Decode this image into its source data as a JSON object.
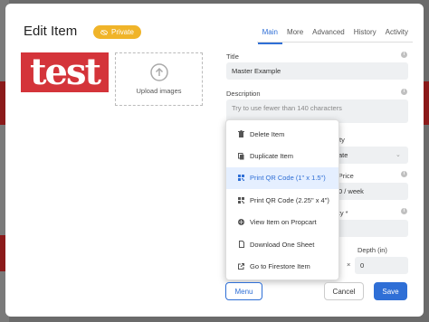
{
  "header": {
    "title": "Edit Item",
    "privacy_badge": "Private"
  },
  "tabs": [
    {
      "label": "Main",
      "active": true
    },
    {
      "label": "More",
      "active": false
    },
    {
      "label": "Advanced",
      "active": false
    },
    {
      "label": "History",
      "active": false
    },
    {
      "label": "Activity",
      "active": false
    }
  ],
  "media": {
    "logo_text": "test",
    "upload_label": "Upload images"
  },
  "form": {
    "title_label": "Title",
    "title_value": "Master Example",
    "description_label": "Description",
    "description_placeholder": "Try to use fewer than 140 characters",
    "visibility_label_partial": "ility",
    "visibility_value_partial": "ate",
    "price_label_partial": "l Price",
    "price_value_partial": "0 / week",
    "quantity_label_partial": "tity *",
    "depth_label": "Depth (in)",
    "depth_value": "0",
    "dimension_separator": "×"
  },
  "menu": {
    "items": [
      {
        "label": "Delete Item",
        "icon": "trash-icon",
        "highlighted": false
      },
      {
        "label": "Duplicate Item",
        "icon": "copy-icon",
        "highlighted": false
      },
      {
        "label": "Print QR Code (1\" x 1.5\")",
        "icon": "qr-code-icon",
        "highlighted": true
      },
      {
        "label": "Print QR Code (2.25\" x 4\")",
        "icon": "qr-code-icon",
        "highlighted": false
      },
      {
        "label": "View Item on Propcart",
        "icon": "globe-icon",
        "highlighted": false
      },
      {
        "label": "Download One Sheet",
        "icon": "document-icon",
        "highlighted": false
      },
      {
        "label": "Go to Firestore Item",
        "icon": "external-link-icon",
        "highlighted": false
      }
    ]
  },
  "footer": {
    "menu_label": "Menu",
    "cancel_label": "Cancel",
    "save_label": "Save"
  },
  "colors": {
    "accent": "#2f6fd6",
    "badge": "#f0b429",
    "logo_bg": "#d4343a"
  }
}
